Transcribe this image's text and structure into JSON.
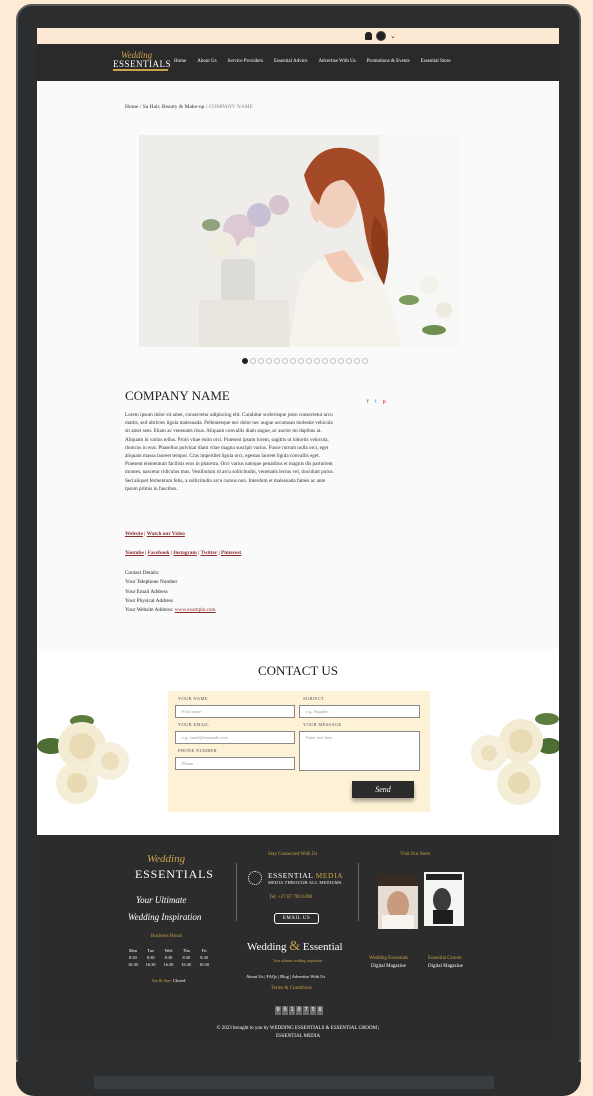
{
  "site": {
    "logo_script": "Wedding",
    "logo_word": "ESSENTIALS",
    "nav": [
      "Home",
      "About Us",
      "Service Providers",
      "Essential Advice",
      "Advertise With Us",
      "Promotions & Events",
      "Essential Store"
    ]
  },
  "breadcrumb": {
    "path": "Home / Sa Hair, Beauty & Make-up / ",
    "current": "COMPANY NAME"
  },
  "company": {
    "name": "COMPANY NAME",
    "description": "Lorem ipsum dolor sit amet, consectetur adipiscing elit. Curabitur scelerisque justo consectetur arcu mattis, sed ultricies ligula malesuada. Pellentesque nec dolor nec augue accumsan molestie vehicula sit amet sem. Etiam ac venenatis risus. Aliquam convallis diam augue, ac auctor mi dapibus at. Aliquam in varius tellus. Proin vitae enim orci. Praesent ipsum lorem, sagittis ut lobortis vehicula, rhoncus in erat. Phasellus pulvinar diam vitae magna suscipit varius. Fusce rutrum nulla orci, eget aliquam massa laoreet tempor. Cras imperdiet ligula orci, egestas laoreet ligula convallis eget. Praesent elementum facilisis eros in pharetra. Orci varius natoque penatibus et magnis dis parturient montes, nascetur ridiculus mus. Vestibulum id arcu sollicitudin, venenatis lectus vel, tincidunt purus. Sed aliquet fermentum felis, a sollicitudin arcu cursus non. Interdum et malesuada fames ac ante ipsum primis in faucibus.",
    "link_website": "Website",
    "link_video": "Watch our Video",
    "social": [
      "Youtube",
      "Facebook",
      "Instagram",
      "Twitter",
      "Pinterest"
    ],
    "details_title": "Contact Details:",
    "phone": "Your Telephone Number",
    "email": "Your Email Address",
    "address": "Your Physical Address",
    "website_label": "Your Website Address: ",
    "website_url": "www.example.com",
    "share": [
      "f",
      "t",
      "p"
    ]
  },
  "slider": {
    "count": 16,
    "active": 0
  },
  "contact": {
    "title": "CONTACT US",
    "name_label": "YOUR NAME",
    "name_ph": "First name",
    "subject_label": "SUBJECT",
    "subject_ph": "e.g. Supplier",
    "email_label": "YOUR EMAIL",
    "email_ph": "e.g. email@example.com",
    "message_label": "YOUR MESSAGE",
    "message_ph": "Enter text here",
    "phone_label": "PHONE NUMBER",
    "phone_ph": "Phone",
    "send": "Send"
  },
  "footer": {
    "tagline1": "Your Ultimate",
    "tagline2": "Wedding Inspiration",
    "hours_title": "Business Hours",
    "days": [
      "Mon",
      "Tue",
      "Wed",
      "Thu",
      "Fri"
    ],
    "open": [
      "8:30",
      "8:30",
      "8:30",
      "8:30",
      "8:30"
    ],
    "close": [
      "16:30",
      "16:30",
      "16:30",
      "16:30",
      "16:30"
    ],
    "weekend_label": "Sat & Sun:",
    "weekend_value": "Closed",
    "connected": "Stay Connected With Us",
    "media_name": "ESSENTIAL",
    "media_name2": "MEDIA",
    "media_sub": "MEDIA THROUGH ALL MEDIUMS",
    "tel": "Tel: +27 87 700 6308",
    "email_btn": "EMAIL US",
    "brand1": "Wedding",
    "brand_amp": "&",
    "brand2": "Essential",
    "brand_sub": "Your ultimate wedding inspiration",
    "links": "About Us  |  FAQs  |  Blog  |  Advertise With Us",
    "terms": "Terms & Conditions",
    "counter": [
      "0",
      "0",
      "1",
      "0",
      "7",
      "5",
      "8"
    ],
    "store_title": "Visit Our Store",
    "mag1_title": "Wedding Essentials",
    "mag1_sub": "Digital Magazine",
    "mag2_title": "Essential Groom",
    "mag2_sub": "Digital Magazine",
    "copyright1": "© 2023 brought to you by WEDDING ESSENTIALS & ESSENTIAL GROOM |",
    "copyright2": "ESSENTIAL MEDIA"
  }
}
